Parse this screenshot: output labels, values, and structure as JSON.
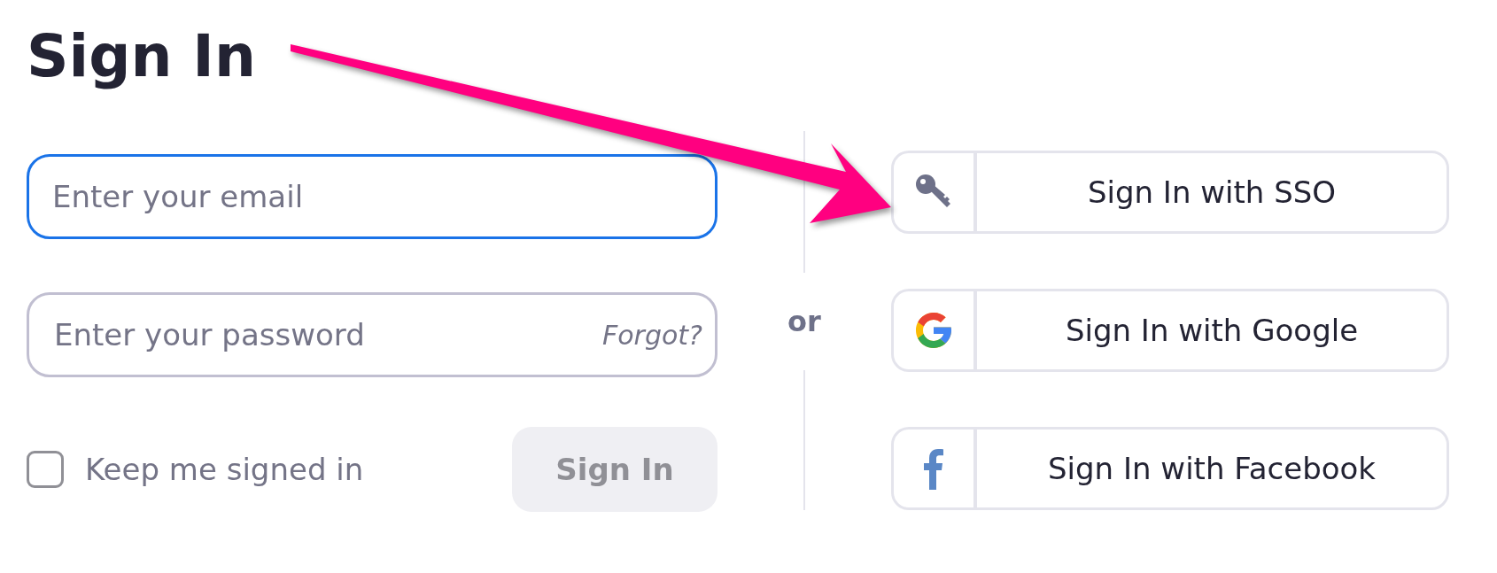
{
  "title": "Sign In",
  "email": {
    "placeholder": "Enter your email",
    "focused": true
  },
  "password": {
    "placeholder": "Enter your password",
    "forgot": "Forgot?"
  },
  "keep_signed_in": {
    "label": "Keep me signed in",
    "checked": false
  },
  "sign_in_button": {
    "label": "Sign In",
    "disabled": true
  },
  "separator": "or",
  "providers": [
    {
      "kind": "sso",
      "label": "Sign In with SSO"
    },
    {
      "kind": "google",
      "label": "Sign In with Google"
    },
    {
      "kind": "facebook",
      "label": "Sign In with Facebook"
    }
  ]
}
